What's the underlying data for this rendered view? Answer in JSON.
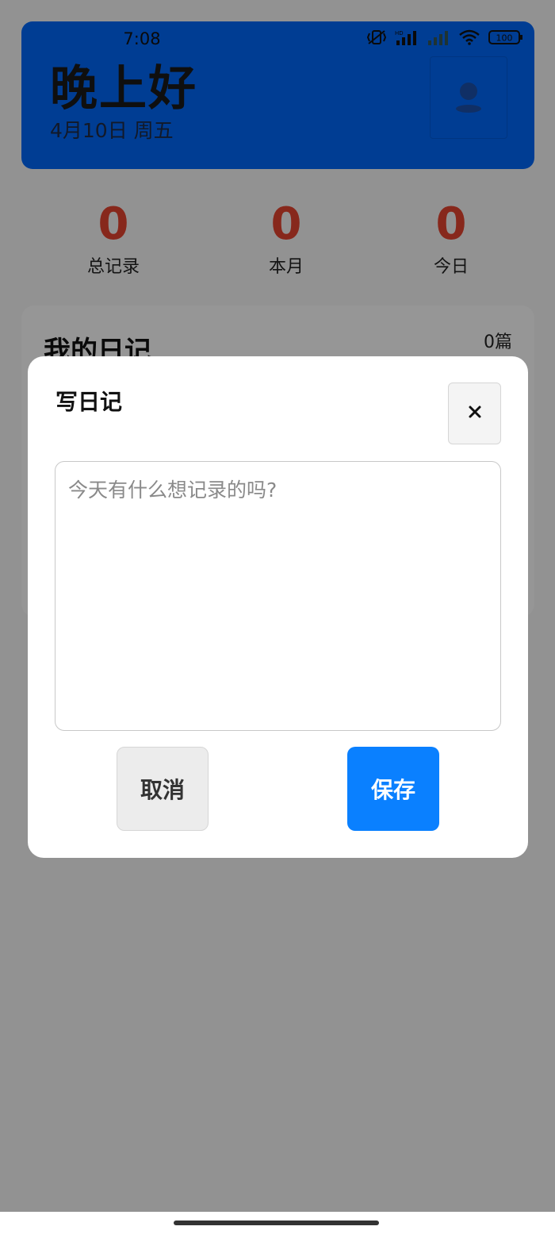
{
  "status_bar": {
    "time": "7:08",
    "battery": "100",
    "icons": [
      "vibrate-icon",
      "hd-signal-icon",
      "signal-icon",
      "signal-empty-icon",
      "wifi-icon",
      "battery-icon"
    ]
  },
  "header": {
    "greeting": "晚上好",
    "date": "4月10日 周五",
    "avatar_icon": "user-avatar-icon",
    "background_color": "#0166f5"
  },
  "stats": [
    {
      "value": "0",
      "label": "总记录"
    },
    {
      "value": "0",
      "label": "本月"
    },
    {
      "value": "0",
      "label": "今日"
    }
  ],
  "diary_section": {
    "title": "我的日记",
    "count": "0篇"
  },
  "modal": {
    "title": "写日记",
    "close_icon": "close-icon",
    "textarea_placeholder": "今天有什么想记录的吗?",
    "textarea_value": "",
    "cancel_label": "取消",
    "save_label": "保存",
    "save_color": "#0a80ff"
  },
  "colors": {
    "stat_number": "#e2432f",
    "overlay": "rgba(0,0,0,0.4)"
  }
}
